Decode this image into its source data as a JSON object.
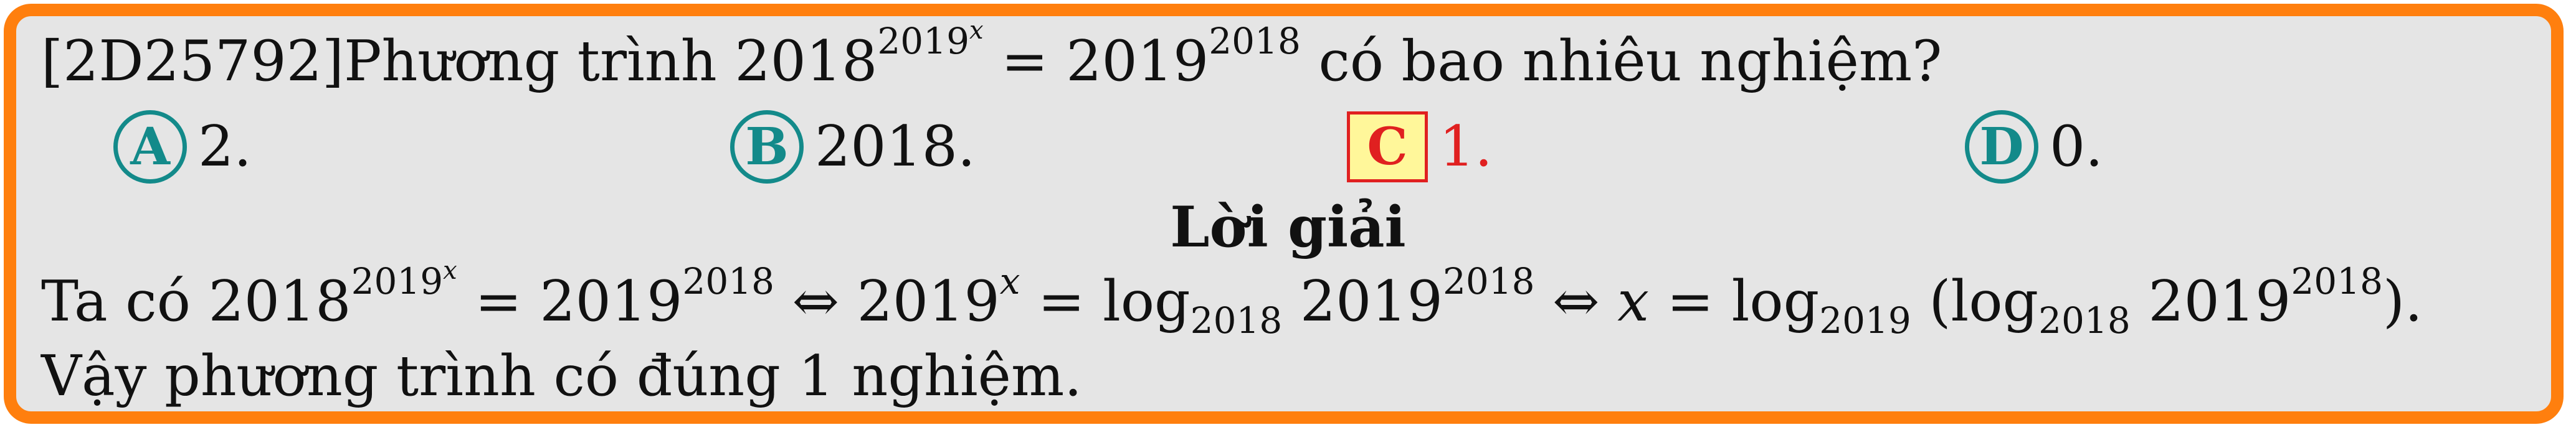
{
  "question": {
    "id": "[2D25792]",
    "text_before": "Phương trình ",
    "lhs_base": "2018",
    "lhs_exp_base": "2019",
    "lhs_exp_exp": "x",
    "eq": " = ",
    "rhs_base": "2019",
    "rhs_exp": "2018",
    "text_after": " có bao nhiêu nghiệm?"
  },
  "options": [
    {
      "letter": "A",
      "text": "2.",
      "correct": false
    },
    {
      "letter": "B",
      "text": "2018.",
      "correct": false
    },
    {
      "letter": "C",
      "text": "1.",
      "correct": true
    },
    {
      "letter": "D",
      "text": "0.",
      "correct": false
    }
  ],
  "solution": {
    "heading": "Lời giải",
    "line1": {
      "lead": "Ta có ",
      "a": "2018",
      "a_exp_base": "2019",
      "a_exp_exp": "x",
      "eq1": " = ",
      "b": "2019",
      "b_exp": "2018",
      "iff1": " ⇔ ",
      "c": "2019",
      "c_exp": "x",
      "eq2": " = ",
      "log1": "log",
      "log1_sub": "2018",
      "d": " 2019",
      "d_exp": "2018",
      "iff2": " ⇔ ",
      "var": "x",
      "eq3": " = ",
      "log2": "log",
      "log2_sub": "2019",
      "open": " (",
      "log3": "log",
      "log3_sub": "2018",
      "e": " 2019",
      "e_exp": "2018",
      "close": ")."
    },
    "line2": "Vậy phương trình có đúng 1 nghiệm."
  },
  "colors": {
    "border": "#ff7f0e",
    "background": "#e5e5e5",
    "teal": "#138a8a",
    "red": "#e02020",
    "highlight": "#fff79a"
  }
}
